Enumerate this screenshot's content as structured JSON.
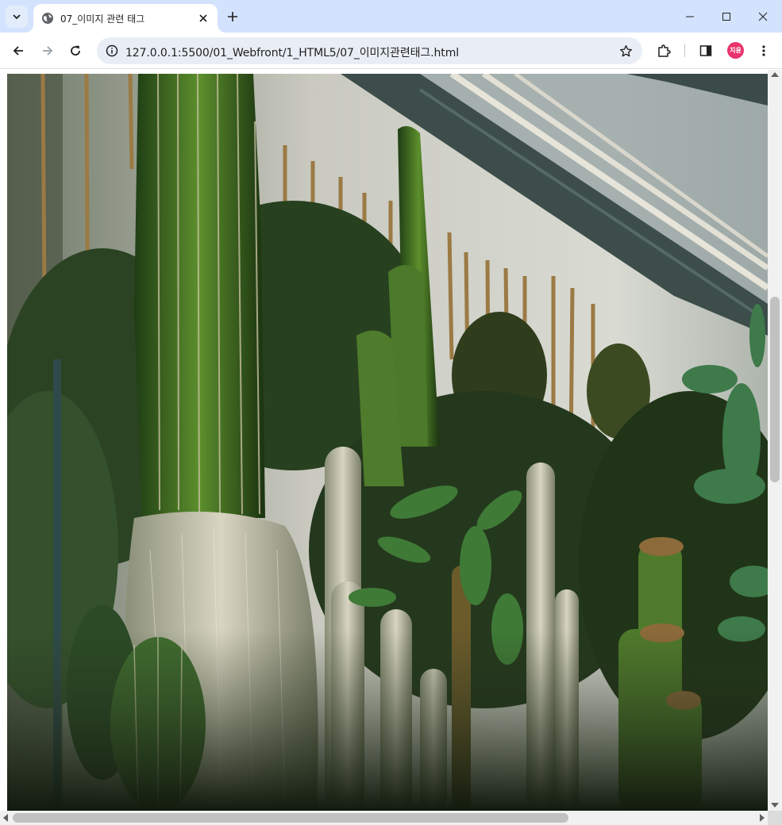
{
  "tab": {
    "title": "07_이미지 관련 태그"
  },
  "address_bar": {
    "url": "127.0.0.1:5500/01_Webfront/1_HTML5/07_이미지관련태그.html"
  },
  "profile": {
    "initials": "지윤"
  },
  "content": {
    "image_subject": "cactus greenhouse photo"
  },
  "colors": {
    "tabstrip": "#d3e3fd",
    "omnibox": "#e9eef6",
    "avatar": "#e8336b"
  }
}
